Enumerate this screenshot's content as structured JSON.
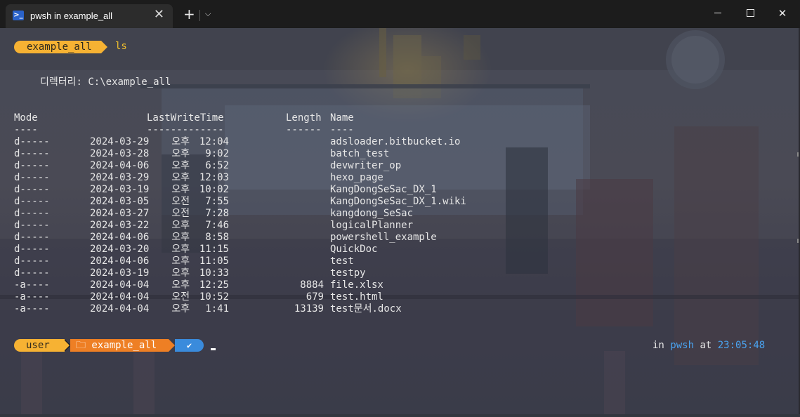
{
  "window": {
    "tab_title": "pwsh in example_all",
    "tab_icon": "powershell-icon",
    "close_tab": "✕",
    "new_tab": "+",
    "dropdown": "⌄",
    "minimize_icon": "minimize-icon",
    "maximize_icon": "maximize-icon",
    "close_window": "✕"
  },
  "prompt1": {
    "folder": "example_all",
    "command": "ls"
  },
  "directory_line": "디렉터리: C:\\example_all",
  "headers": {
    "mode": "Mode",
    "lastwrite": "LastWriteTime",
    "length": "Length",
    "name": "Name"
  },
  "underlines": {
    "mode": "----",
    "lastwrite": "-------------",
    "length": "------",
    "name": "----"
  },
  "rows": [
    {
      "mode": "d-----",
      "date": "2024-03-29",
      "ampm": "오후",
      "time": "12:04",
      "length": "",
      "name": "adsloader.bitbucket.io"
    },
    {
      "mode": "d-----",
      "date": "2024-03-28",
      "ampm": "오후",
      "time": "9:02",
      "length": "",
      "name": "batch_test"
    },
    {
      "mode": "d-----",
      "date": "2024-04-06",
      "ampm": "오후",
      "time": "6:52",
      "length": "",
      "name": "devwriter_op"
    },
    {
      "mode": "d-----",
      "date": "2024-03-29",
      "ampm": "오후",
      "time": "12:03",
      "length": "",
      "name": "hexo_page"
    },
    {
      "mode": "d-----",
      "date": "2024-03-19",
      "ampm": "오후",
      "time": "10:02",
      "length": "",
      "name": "KangDongSeSac_DX_1"
    },
    {
      "mode": "d-----",
      "date": "2024-03-05",
      "ampm": "오전",
      "time": "7:55",
      "length": "",
      "name": "KangDongSeSac_DX_1.wiki"
    },
    {
      "mode": "d-----",
      "date": "2024-03-27",
      "ampm": "오전",
      "time": "7:28",
      "length": "",
      "name": "kangdong_SeSac"
    },
    {
      "mode": "d-----",
      "date": "2024-03-22",
      "ampm": "오후",
      "time": "7:46",
      "length": "",
      "name": "logicalPlanner"
    },
    {
      "mode": "d-----",
      "date": "2024-04-06",
      "ampm": "오후",
      "time": "8:58",
      "length": "",
      "name": "powershell_example"
    },
    {
      "mode": "d-----",
      "date": "2024-03-20",
      "ampm": "오후",
      "time": "11:15",
      "length": "",
      "name": "QuickDoc"
    },
    {
      "mode": "d-----",
      "date": "2024-04-06",
      "ampm": "오후",
      "time": "11:05",
      "length": "",
      "name": "test"
    },
    {
      "mode": "d-----",
      "date": "2024-03-19",
      "ampm": "오후",
      "time": "10:33",
      "length": "",
      "name": "testpy"
    },
    {
      "mode": "-a----",
      "date": "2024-04-04",
      "ampm": "오후",
      "time": "12:25",
      "length": "8884",
      "name": "file.xlsx"
    },
    {
      "mode": "-a----",
      "date": "2024-04-04",
      "ampm": "오전",
      "time": "10:52",
      "length": "679",
      "name": "test.html"
    },
    {
      "mode": "-a----",
      "date": "2024-04-04",
      "ampm": "오후",
      "time": "1:41",
      "length": "13139",
      "name": "test문서.docx"
    }
  ],
  "prompt2": {
    "user": "user",
    "folder": "🗀 example_all",
    "status": "✔",
    "right_in": "in",
    "right_shell": "pwsh",
    "right_at": "at",
    "right_time": "23:05:48"
  },
  "colors": {
    "prompt_yellow": "#f6b233",
    "prompt_orange": "#ee7f24",
    "prompt_blue": "#3a8bdc",
    "time_blue": "#4aa3f0",
    "command_yellow": "#f4c22c"
  }
}
